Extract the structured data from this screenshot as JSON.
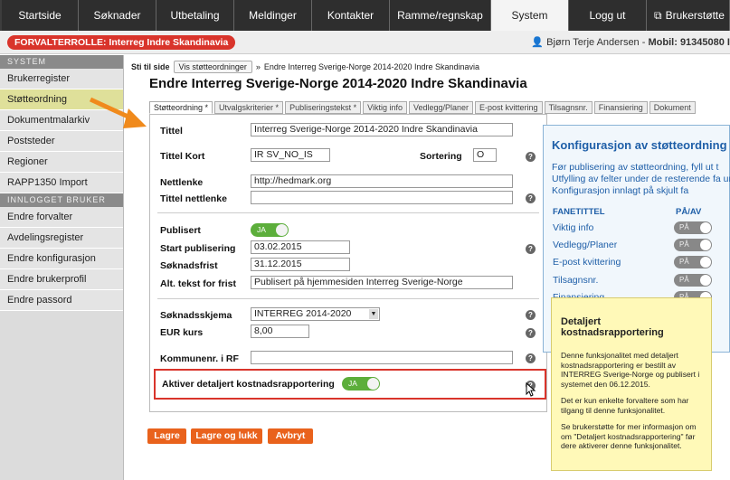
{
  "nav": {
    "tabs": [
      "Startside",
      "Søknader",
      "Utbetaling",
      "Meldinger",
      "Kontakter",
      "Ramme/regnskap",
      "System",
      "Logg ut",
      "Brukerstøtte"
    ],
    "active": "System"
  },
  "role": "FORVALTERROLLE: Interreg Indre Skandinavia",
  "user": {
    "name": "Bjørn Terje Andersen",
    "separator": "-",
    "mobile_label": "Mobil:",
    "mobile": "91345080 I"
  },
  "sidebar": {
    "system_header": "SYSTEM",
    "system_items": [
      "Brukerregister",
      "Støtteordning",
      "Dokumentmalarkiv",
      "Poststeder",
      "Regioner",
      "RAPP1350 Import"
    ],
    "active": "Støtteordning",
    "user_header": "INNLOGGET BRUKER",
    "user_items": [
      "Endre forvalter",
      "Avdelingsregister",
      "Endre konfigurasjon",
      "Endre brukerprofil",
      "Endre passord"
    ]
  },
  "breadcrumb": {
    "prefix": "Sti til side",
    "sep": "»",
    "button": "Vis støtteordninger",
    "current": "Endre Interreg Sverige-Norge 2014-2020 Indre Skandinavia"
  },
  "page_title": "Endre Interreg Sverige-Norge 2014-2020 Indre Skandinavia",
  "tabs": [
    "Støtteordning *",
    "Utvalgskriterier *",
    "Publiseringstekst *",
    "Viktig info",
    "Vedlegg/Planer",
    "E-post kvittering",
    "Tilsagnsnr.",
    "Finansiering",
    "Dokument"
  ],
  "form": {
    "tittel_label": "Tittel",
    "tittel": "Interreg Sverige-Norge 2014-2020 Indre Skandinavia",
    "tittel_kort_label": "Tittel Kort",
    "tittel_kort": "IR SV_NO_IS",
    "sortering_label": "Sortering",
    "sortering": "O",
    "nettlenke_label": "Nettlenke",
    "nettlenke": "http://hedmark.org",
    "tittel_nettlenke_label": "Tittel nettlenke",
    "tittel_nettlenke": "",
    "publisert_label": "Publisert",
    "publisert": "JA",
    "start_label": "Start publisering",
    "start": "03.02.2015",
    "frist_label": "Søknadsfrist",
    "frist": "31.12.2015",
    "alt_label": "Alt. tekst for frist",
    "alt": "Publisert på hjemmesiden Interreg Sverige-Norge",
    "skjema_label": "Søknadsskjema",
    "skjema": "INTERREG 2014-2020",
    "eur_label": "EUR kurs",
    "eur": "8,00",
    "kommune_label": "Kommunenr. i RF",
    "kommune": "",
    "detaljert_label": "Aktiver detaljert kostnadsrapportering",
    "detaljert": "JA",
    "help_symbol": "?"
  },
  "buttons": {
    "lagre": "Lagre",
    "lagre_lukk": "Lagre og lukk",
    "avbryt": "Avbryt"
  },
  "config": {
    "title": "Konfigurasjon av støtteordning",
    "text": "Før publisering av støtteordning, fyll ut t Utfylling av felter under de resterende fa under. Konfigurasjon innlagt på skjult fa",
    "col_tab": "FANETITTEL",
    "col_onoff": "PÅ/AV",
    "rows": [
      "Viktig info",
      "Vedlegg/Planer",
      "E-post kvittering",
      "Tilsagnsnr.",
      "Finansiering"
    ],
    "toggle_label": "PÅ"
  },
  "tooltip": {
    "title": "Detaljert kostnadsrapportering",
    "p1": "Denne funksjonalitet med detaljert kostnadsrapportering er bestilt av INTERREG Sverige-Norge og publisert i systemet den 06.12.2015.",
    "p2": "Det er kun enkelte forvaltere som har tilgang til denne funksjonalitet.",
    "p3": "Se brukerstøtte for mer informasjon om om \"Detaljert kostnadsrapportering\" før dere aktiverer denne funksjonalitet."
  },
  "colors": {
    "accent_red": "#d9342b",
    "orange": "#e9621c",
    "green": "#5cae3b",
    "blue": "#1f5fa8",
    "highlight": "#dfe09a"
  }
}
